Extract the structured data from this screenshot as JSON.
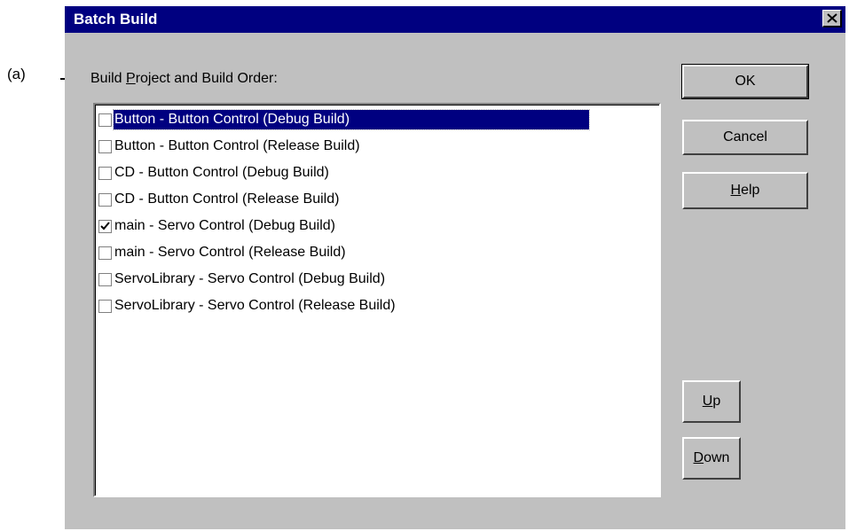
{
  "annotation": {
    "label": "(a)"
  },
  "dialog": {
    "title": "Batch Build",
    "list_label": "Build Project and Build Order:",
    "items": [
      {
        "label": "Button - Button Control (Debug Build)",
        "checked": false,
        "selected": true
      },
      {
        "label": "Button - Button Control (Release Build)",
        "checked": false,
        "selected": false
      },
      {
        "label": "CD - Button Control (Debug Build)",
        "checked": false,
        "selected": false
      },
      {
        "label": "CD - Button Control (Release Build)",
        "checked": false,
        "selected": false
      },
      {
        "label": "main - Servo Control (Debug Build)",
        "checked": true,
        "selected": false
      },
      {
        "label": "main - Servo Control (Release Build)",
        "checked": false,
        "selected": false
      },
      {
        "label": "ServoLibrary - Servo Control (Debug Build)",
        "checked": false,
        "selected": false
      },
      {
        "label": "ServoLibrary - Servo Control (Release Build)",
        "checked": false,
        "selected": false
      }
    ],
    "buttons": {
      "ok": "OK",
      "cancel": "Cancel",
      "help": "Help",
      "up": "Up",
      "down": "Down"
    }
  }
}
